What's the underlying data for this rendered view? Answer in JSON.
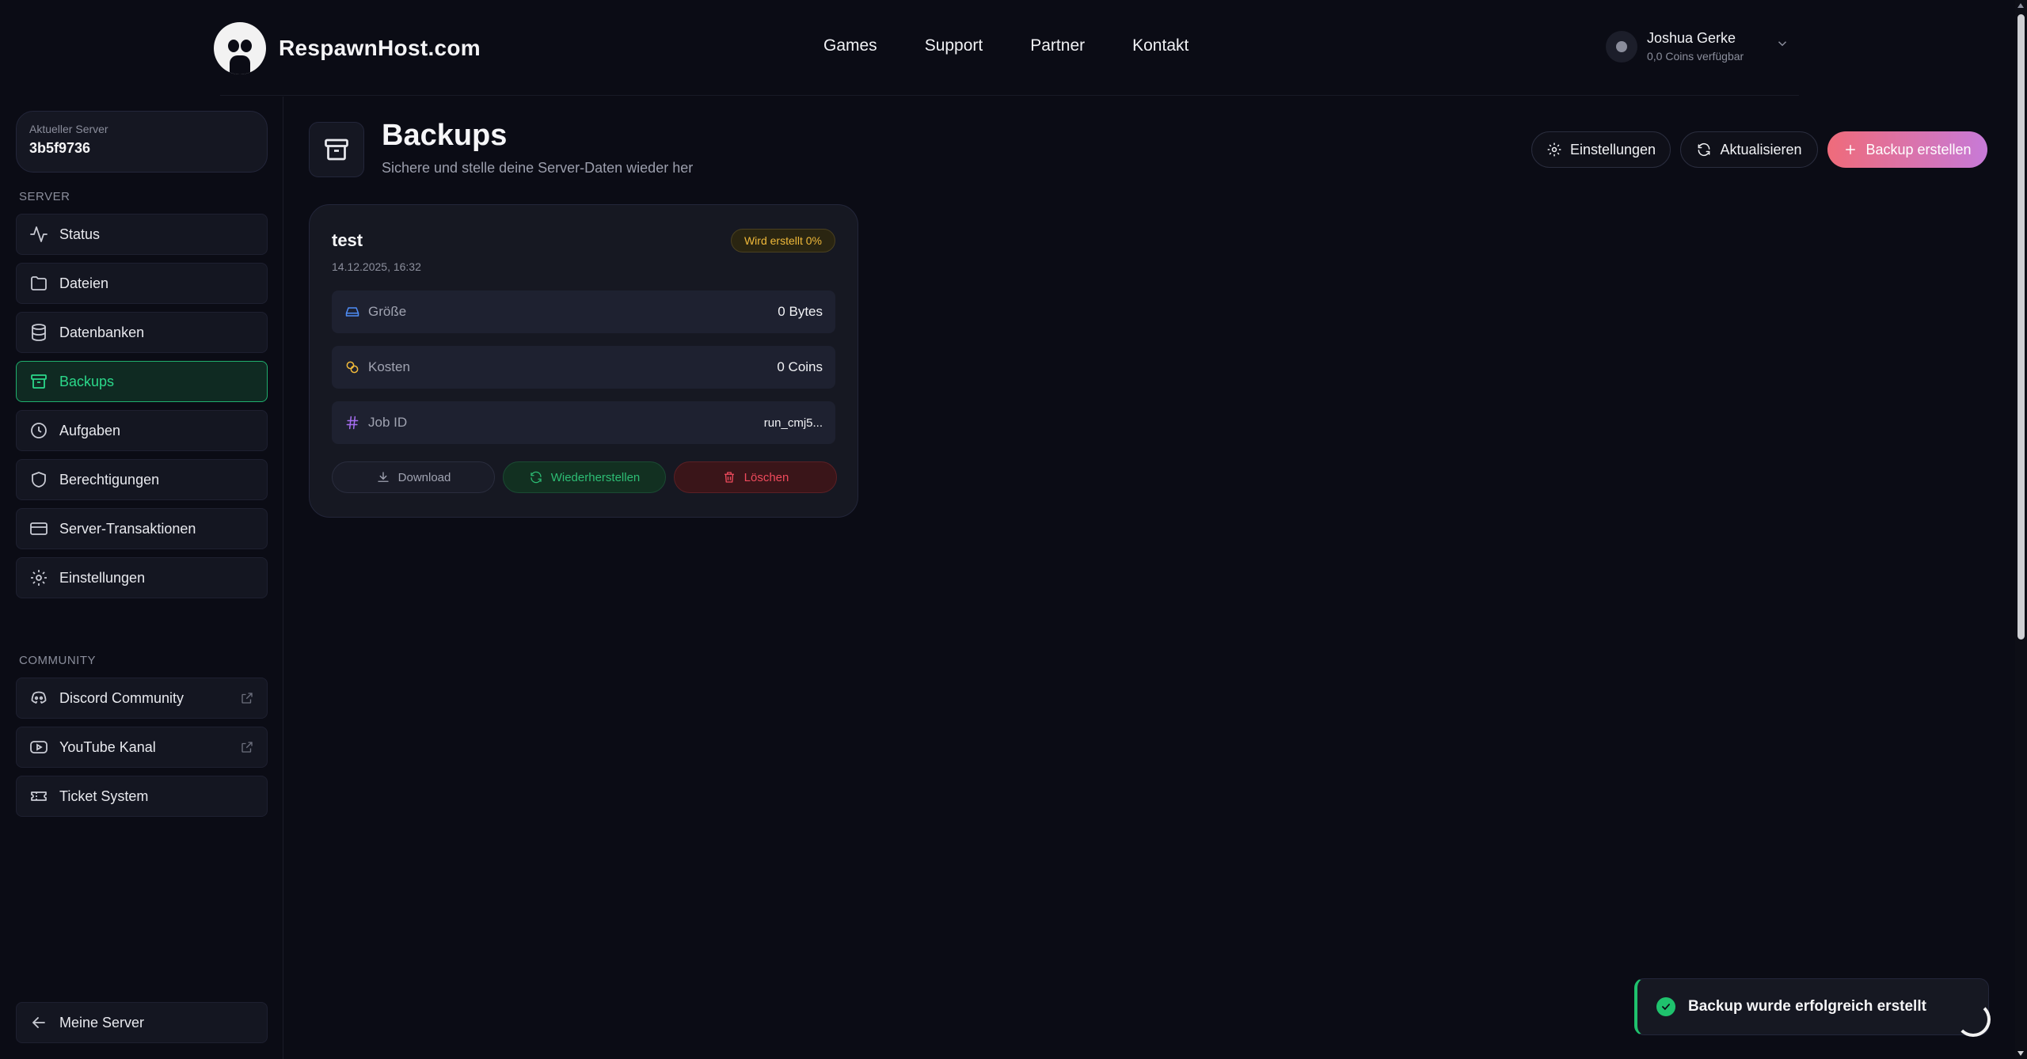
{
  "header": {
    "logo_text": "RespawnHost.com",
    "nav": [
      "Games",
      "Support",
      "Partner",
      "Kontakt"
    ],
    "user": {
      "name": "Joshua Gerke",
      "coins": "0,0 Coins verfügbar"
    }
  },
  "sidebar": {
    "current_server_label": "Aktueller Server",
    "current_server_value": "3b5f9736",
    "server_section": "SERVER",
    "server_items": [
      {
        "label": "Status",
        "icon": "activity-icon"
      },
      {
        "label": "Dateien",
        "icon": "folder-icon"
      },
      {
        "label": "Datenbanken",
        "icon": "database-icon"
      },
      {
        "label": "Backups",
        "icon": "archive-icon",
        "active": true
      },
      {
        "label": "Aufgaben",
        "icon": "clock-icon"
      },
      {
        "label": "Berechtigungen",
        "icon": "shield-icon"
      },
      {
        "label": "Server-Transaktionen",
        "icon": "credit-card-icon"
      },
      {
        "label": "Einstellungen",
        "icon": "gear-icon"
      }
    ],
    "community_section": "COMMUNITY",
    "community_items": [
      {
        "label": "Discord Community",
        "icon": "discord-icon",
        "external": true
      },
      {
        "label": "YouTube Kanal",
        "icon": "youtube-icon",
        "external": true
      },
      {
        "label": "Ticket System",
        "icon": "ticket-icon"
      }
    ],
    "back_label": "Meine Server"
  },
  "page": {
    "title": "Backups",
    "subtitle": "Sichere und stelle deine Server-Daten wieder her",
    "buttons": {
      "settings": "Einstellungen",
      "refresh": "Aktualisieren",
      "create": "Backup erstellen"
    }
  },
  "backup_card": {
    "name": "test",
    "date": "14.12.2025, 16:32",
    "status": "Wird erstellt 0%",
    "rows": [
      {
        "label": "Größe",
        "value": "0 Bytes"
      },
      {
        "label": "Kosten",
        "value": "0 Coins"
      },
      {
        "label": "Job ID",
        "value": "run_cmj5..."
      }
    ],
    "actions": {
      "download": "Download",
      "restore": "Wiederherstellen",
      "delete": "Löschen"
    }
  },
  "toast": {
    "message": "Backup wurde erfolgreich erstellt"
  },
  "colors": {
    "background": "#0b0c15",
    "accent_green": "#2bd88a",
    "danger": "#ef4a5c",
    "warning": "#f0b93a",
    "primary_gradient_start": "#ef6b7a",
    "primary_gradient_end": "#c77ad8"
  }
}
